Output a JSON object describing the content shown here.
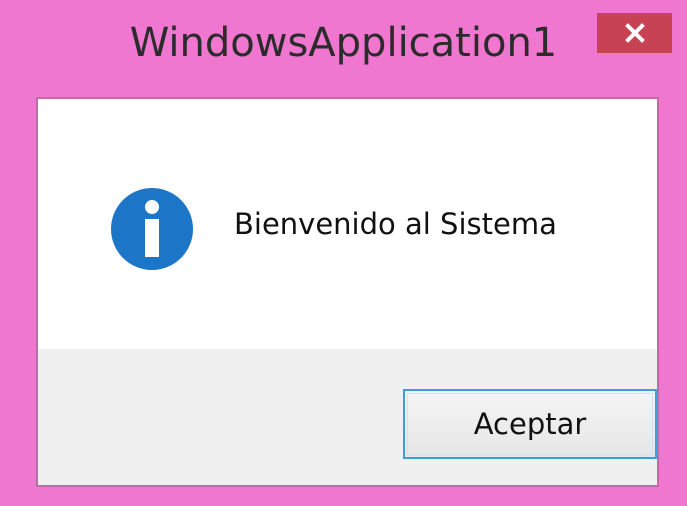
{
  "window": {
    "title": "WindowsApplication1",
    "close_icon": "close-icon"
  },
  "dialog": {
    "icon": "info-icon",
    "message": "Bienvenido al Sistema",
    "accept_label": "Aceptar"
  },
  "colors": {
    "frame": "#ef77d0",
    "close_button": "#c74353",
    "info_icon": "#1c75c6",
    "button_border": "#3c9de0",
    "button_bar": "#f0f0f0"
  }
}
